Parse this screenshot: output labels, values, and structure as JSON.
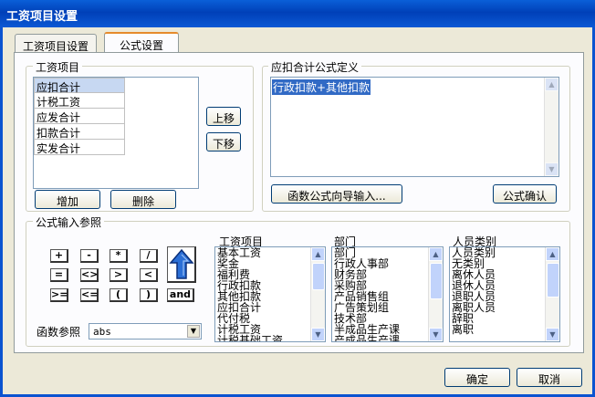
{
  "window": {
    "title": "工资项目设置"
  },
  "tabs": [
    {
      "label": "工资项目设置"
    },
    {
      "label": "公式设置"
    }
  ],
  "salary_items": {
    "legend": "工资项目",
    "rows": [
      "应扣合计",
      "计税工资",
      "应发合计",
      "扣款合计",
      "实发合计"
    ],
    "move_up": "上移",
    "move_down": "下移",
    "add": "增加",
    "delete": "删除"
  },
  "formula_def": {
    "legend": "应扣合计公式定义",
    "text": "行政扣款+其他扣款",
    "wizard": "函数公式向导输入...",
    "confirm": "公式确认"
  },
  "reference": {
    "legend": "公式输入参照",
    "operators_row1": [
      "+",
      "-",
      "*",
      "/"
    ],
    "operators_row2": [
      "=",
      "<>",
      ">",
      "<"
    ],
    "operators_row3": [
      ">=",
      "<=",
      "(",
      ")"
    ],
    "and_label": "and",
    "func_label": "函数参照",
    "func_value": "abs",
    "salary_list": {
      "title": "工资项目",
      "items": [
        "基本工资",
        "奖金",
        "福利费",
        "行政扣款",
        "其他扣款",
        "应扣合计",
        "代付税",
        "计税工资",
        "计税基础工资"
      ]
    },
    "dept_list": {
      "title": "部门",
      "items": [
        "部门",
        "行政人事部",
        "财务部",
        "采购部",
        "产品销售组",
        "广告策划组",
        "技术部",
        "半成品生产课",
        "产成品生产课"
      ]
    },
    "staff_list": {
      "title": "人员类别",
      "items": [
        "人员类别",
        "无类别",
        "离休人员",
        "退休人员",
        "退职人员",
        "离职人员",
        "辞职",
        "离职"
      ]
    }
  },
  "footer": {
    "ok": "确定",
    "cancel": "取消"
  }
}
